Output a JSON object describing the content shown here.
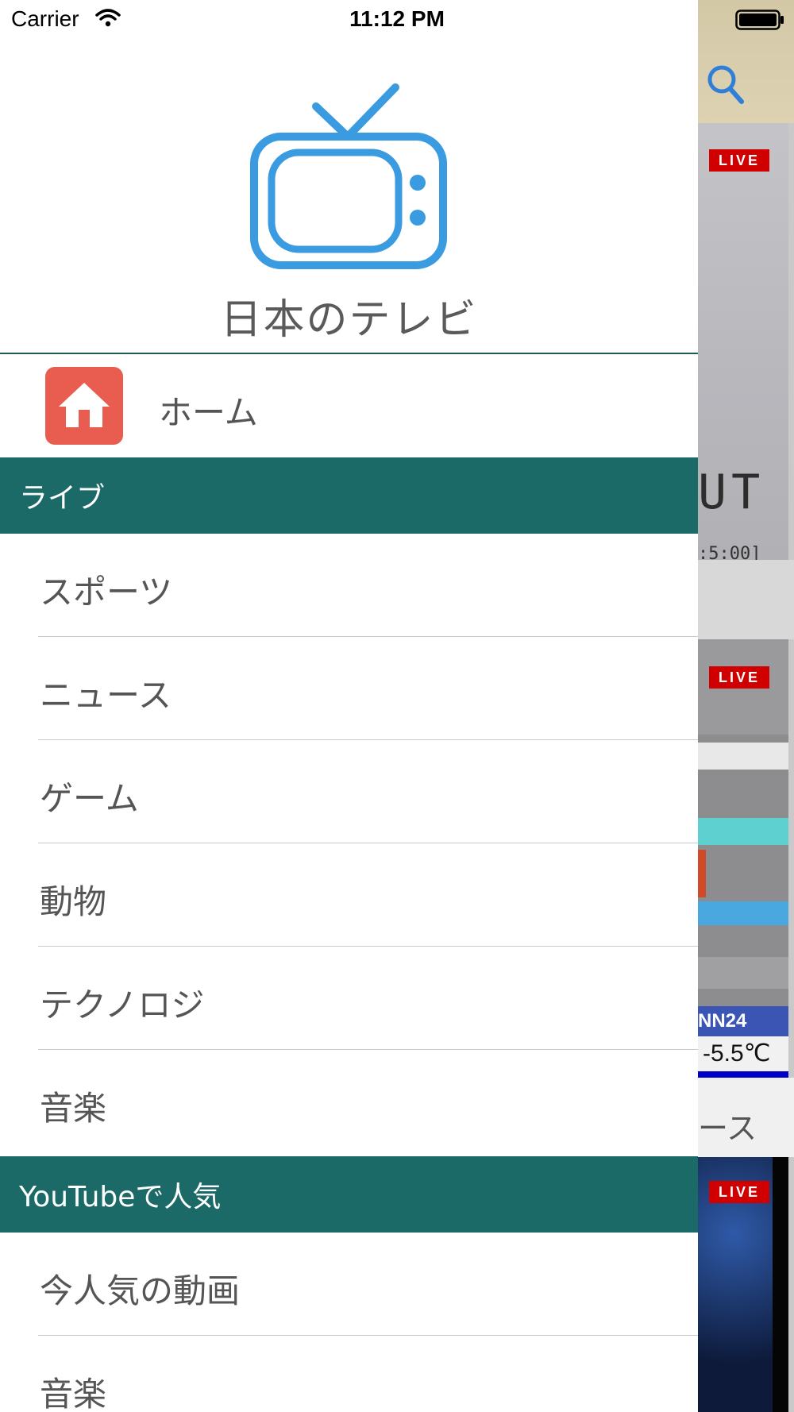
{
  "status_bar": {
    "carrier": "Carrier",
    "time": "11:12 PM"
  },
  "drawer": {
    "app_title": "日本のテレビ",
    "home": {
      "label": "ホーム",
      "icon": "home-icon"
    },
    "sections": [
      {
        "title": "ライブ",
        "items": [
          "スポーツ",
          "ニュース",
          "ゲーム",
          "動物",
          "テクノロジ",
          "音楽"
        ]
      },
      {
        "title": "YouTubeで人気",
        "items": [
          "今人気の動画",
          "音楽"
        ]
      }
    ]
  },
  "background_app": {
    "live_badge": "LIVE",
    "thumb1_text": "UT",
    "thumb1_time": ":5:00]",
    "thumb2_channel": "NN24",
    "thumb2_temp": "-5.5℃",
    "middle_text": "ース"
  },
  "colors": {
    "section_header": "#1b6a68",
    "tv_icon": "#3a9be0",
    "home_tile": "#e85d4f",
    "live_badge": "#d10000"
  }
}
